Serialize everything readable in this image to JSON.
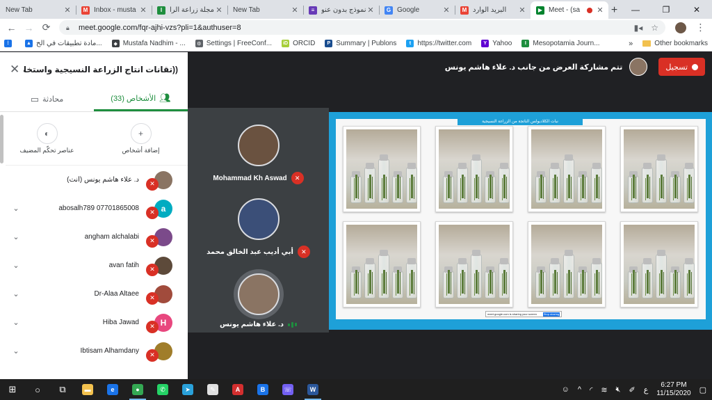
{
  "browser": {
    "tabs": [
      {
        "label": "New Tab",
        "fav": "",
        "favColor": "#ffffff",
        "active": false
      },
      {
        "label": "Inbox - musta",
        "fav": "M",
        "favColor": "#ea4335",
        "active": false
      },
      {
        "label": "مجلة زراعة الرا",
        "fav": "I",
        "favColor": "#1e8e3e",
        "active": false
      },
      {
        "label": "New Tab",
        "fav": "",
        "favColor": "#ffffff",
        "active": false
      },
      {
        "label": "نموذج بدون عنو",
        "fav": "≡",
        "favColor": "#673ab7",
        "active": false
      },
      {
        "label": "Google",
        "fav": "G",
        "favColor": "#4285f4",
        "active": false
      },
      {
        "label": "البريد الوارد",
        "fav": "M",
        "favColor": "#ea4335",
        "active": false
      },
      {
        "label": "Meet - (sa",
        "fav": "▶",
        "favColor": "#00832d",
        "active": true
      }
    ],
    "url": "meet.google.com/fqr-ajhi-vzs?pli=1&authuser=8",
    "bookmarks": [
      {
        "label": "مادة تطبيقات في الح...",
        "icon": "▲",
        "color": "#1a73e8"
      },
      {
        "label": "Mustafa Nadhim - ...",
        "icon": "◆",
        "color": "#3c4043"
      },
      {
        "label": "Settings | FreeConf...",
        "icon": "⚙",
        "color": "#5f6368"
      },
      {
        "label": "ORCID",
        "icon": "iD",
        "color": "#a6ce39"
      },
      {
        "label": "Summary | Publons",
        "icon": "P",
        "color": "#1a4d8f"
      },
      {
        "label": "https://twitter.com",
        "icon": "t",
        "color": "#1da1f2"
      },
      {
        "label": "Yahoo",
        "icon": "Y",
        "color": "#6001d2"
      },
      {
        "label": "Mesopotamia Journ...",
        "icon": "I",
        "color": "#1e8e3e"
      }
    ],
    "bookmarks_more": "»",
    "other_bookmarks": "Other bookmarks"
  },
  "panel": {
    "title": "((تقانات انتاج الزراعة النسيجية واستخلاص الو...",
    "tab_people": "الأشخاص (33)",
    "tab_chat": "محادثة",
    "action_add": "إضافة أشخاص",
    "action_host": "عناصر تحكّم المضيف",
    "people": [
      {
        "name": "د. علاء هاشم يونس (أنت)",
        "avatar": "",
        "avColor": "#8a7463",
        "expand": false
      },
      {
        "name": "abosalh789 07701865008",
        "avatar": "a",
        "avColor": "#00acc1",
        "expand": true
      },
      {
        "name": "angham alchalabi",
        "avatar": "",
        "avColor": "#7b4a8a",
        "expand": true
      },
      {
        "name": "avan fatih",
        "avatar": "",
        "avColor": "#5d4a3a",
        "expand": true
      },
      {
        "name": "Dr-Alaa Altaee",
        "avatar": "",
        "avColor": "#a14b3c",
        "expand": true
      },
      {
        "name": "Hiba Jawad",
        "avatar": "H",
        "avColor": "#e8477e",
        "expand": true
      },
      {
        "name": "Ibtisam Alhamdany",
        "avatar": "",
        "avColor": "#a07d2a",
        "expand": true
      }
    ]
  },
  "meet": {
    "presenting_text": "تتم مشاركة العرض من جانب د. علاء هاشم يونس",
    "record_label": "تسجيل",
    "tiles": [
      {
        "name": "Mohammad Kh Aswad",
        "avColor": "#6a5240",
        "muted": true
      },
      {
        "name": "أبي أديب عبد الخالق محمد",
        "avColor": "#3b4f78",
        "muted": true
      },
      {
        "name": "د. علاء هاشم يونس",
        "avColor": "#8a7463",
        "muted": false
      }
    ],
    "slide_title": "نبات الكلاديولس الناتجة من الزراعة النسيجية",
    "slide_bar_text": "meet.google.com is sharing your screen",
    "slide_bar_button": "Stop sharing"
  },
  "taskbar": {
    "apps": [
      {
        "name": "file-explorer",
        "glyph": "▬",
        "color": "#f2c14e"
      },
      {
        "name": "edge",
        "glyph": "e",
        "color": "#1a73e8"
      },
      {
        "name": "chrome",
        "glyph": "●",
        "color": "#34a853"
      },
      {
        "name": "whatsapp",
        "glyph": "✆",
        "color": "#25d366"
      },
      {
        "name": "telegram",
        "glyph": "➤",
        "color": "#2aa1da"
      },
      {
        "name": "paint",
        "glyph": "✎",
        "color": "#e0e0e0"
      },
      {
        "name": "acrobat",
        "glyph": "A",
        "color": "#d32f2f"
      },
      {
        "name": "bluetooth",
        "glyph": "B",
        "color": "#1a73e8"
      },
      {
        "name": "viber",
        "glyph": "☏",
        "color": "#7360f2"
      },
      {
        "name": "word",
        "glyph": "W",
        "color": "#2b579a"
      }
    ],
    "lang": "ع",
    "time": "6:27 PM",
    "date": "11/15/2020"
  }
}
